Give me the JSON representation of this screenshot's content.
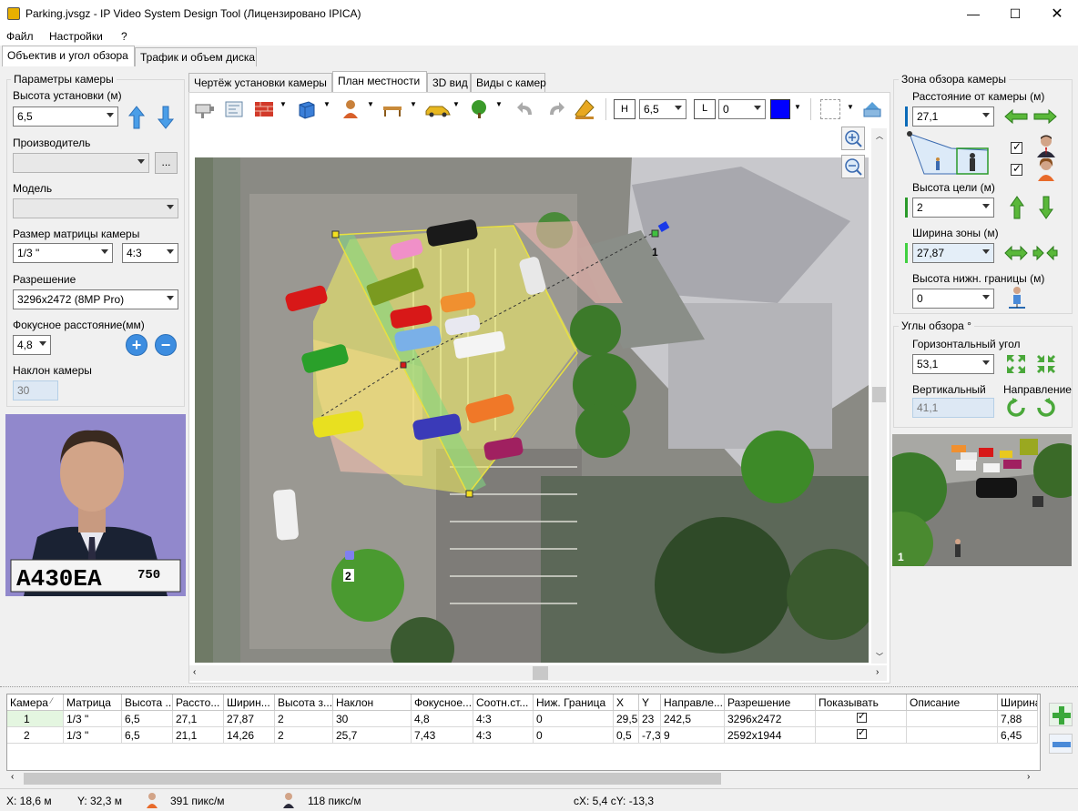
{
  "window": {
    "title": "Parking.jvsgz - IP Video System Design Tool (Лицензировано  IPICA)"
  },
  "menu": [
    "Файл",
    "Настройки",
    "?"
  ],
  "left_tabs": [
    "Объектив и угол обзора",
    "Трафик и объем диска"
  ],
  "camera_params": {
    "title": "Параметры камеры",
    "height_label": "Высота установки (м)",
    "height_value": "6,5",
    "manufacturer_label": "Производитель",
    "manufacturer_value": "",
    "browse_label": "...",
    "model_label": "Модель",
    "model_value": "",
    "sensor_label": "Размер матрицы камеры",
    "sensor_value": "1/3 \"",
    "aspect_value": "4:3",
    "resolution_label": "Разрешение",
    "resolution_value": "3296x2472 (8MP Pro)",
    "focal_label": "Фокусное расстояние(мм)",
    "focal_value": "4,8",
    "tilt_label": "Наклон камеры",
    "tilt_value": "30"
  },
  "preview": {
    "plate_text": "A430EA",
    "plate_region": "750"
  },
  "center_tabs": [
    "Чертёж установки камеры",
    "План местности",
    "3D вид",
    "Виды с камер"
  ],
  "toolbar": {
    "height_value": "6,5",
    "height_icon_label": "H",
    "length_icon_label": "L",
    "length_value": "0",
    "color": "#0000ff"
  },
  "map": {
    "camera1_label": "1",
    "camera2_label": "2"
  },
  "view_zone": {
    "title": "Зона обзора камеры",
    "distance_label": "Расстояние от камеры (м)",
    "distance_value": "27,1",
    "target_height_label": "Высота цели (м)",
    "target_height_value": "2",
    "zone_width_label": "Ширина зоны (м)",
    "zone_width_value": "27,87",
    "lower_height_label": "Высота нижн. границы (м)",
    "lower_height_value": "0"
  },
  "view_angles": {
    "title": "Углы обзора °",
    "horizontal_label": "Горизонтальный угол",
    "horizontal_value": "53,1",
    "vertical_label": "Вертикальный",
    "vertical_value": "41,1",
    "direction_label": "Направление"
  },
  "cam_preview": {
    "label": "1"
  },
  "table": {
    "columns": [
      "Камера",
      "Матрица",
      "Высота ...",
      "Рассто...",
      "Ширин...",
      "Высота з...",
      "Наклон",
      "Фокусное...",
      "Соотн.ст...",
      "Ниж. Граница",
      "X",
      "Y",
      "Направле...",
      "Разрешение",
      "Показывать",
      "Описание",
      "Ширина"
    ],
    "rows": [
      [
        "1",
        "1/3 \"",
        "6,5",
        "27,1",
        "27,87",
        "2",
        "30",
        "4,8",
        "4:3",
        "0",
        "29,5",
        "23",
        "242,5",
        "3296x2472",
        "",
        "",
        "7,88"
      ],
      [
        "2",
        "1/3 \"",
        "6,5",
        "21,1",
        "14,26",
        "2",
        "25,7",
        "7,43",
        "4:3",
        "0",
        "0,5",
        "-7,3",
        "9",
        "2592x1944",
        "",
        "",
        "6,45"
      ]
    ]
  },
  "status": {
    "x": "X: 18,6 м",
    "y": "Y: 32,3 м",
    "px1": "391 пикс/м",
    "px2": "118 пикс/м",
    "cxy": "cX: 5,4 cY: -13,3"
  }
}
